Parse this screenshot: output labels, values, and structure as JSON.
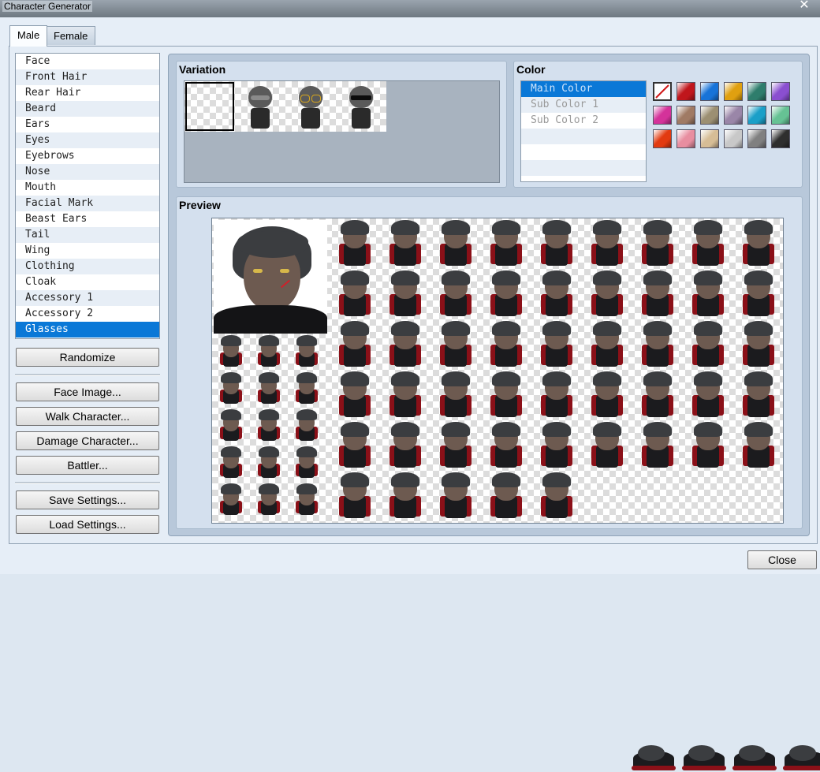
{
  "window": {
    "title": "Character Generator"
  },
  "tabs": [
    {
      "label": "Male",
      "active": true
    },
    {
      "label": "Female",
      "active": false
    }
  ],
  "parts": [
    "Face",
    "Front Hair",
    "Rear Hair",
    "Beard",
    "Ears",
    "Eyes",
    "Eyebrows",
    "Nose",
    "Mouth",
    "Facial Mark",
    "Beast Ears",
    "Tail",
    "Wing",
    "Clothing",
    "Cloak",
    "Accessory 1",
    "Accessory 2",
    "Glasses"
  ],
  "selected_part": "Glasses",
  "buttons": {
    "randomize": "Randomize",
    "face_image": "Face Image...",
    "walk_character": "Walk Character...",
    "damage_character": "Damage Character...",
    "battler": "Battler...",
    "save_settings": "Save Settings...",
    "load_settings": "Load Settings...",
    "close": "Close"
  },
  "variation": {
    "label": "Variation",
    "options": [
      "none",
      "plain",
      "gold-frame",
      "sunglasses"
    ],
    "selected_index": 0
  },
  "color": {
    "label": "Color",
    "slots": [
      "Main Color",
      "Sub Color 1",
      "Sub Color 2"
    ],
    "selected_slot": "Main Color",
    "swatches": [
      "none",
      "#c0161c",
      "#1773d8",
      "#e0a010",
      "#2e7d6c",
      "#8a4fd0",
      "#d4329a",
      "#a07a64",
      "#9c8f72",
      "#9a86a8",
      "#1a9fc8",
      "#66c294",
      "#e23a10",
      "#e88ea0",
      "#d6bd96",
      "#c8c8c8",
      "#808080",
      "#2e2e2e"
    ]
  },
  "preview": {
    "label": "Preview"
  },
  "colors": {
    "selection": "#0a78d7",
    "panel_bg": "#b8c8da",
    "hair": "#3b3d40",
    "cape": "#8b1018"
  }
}
